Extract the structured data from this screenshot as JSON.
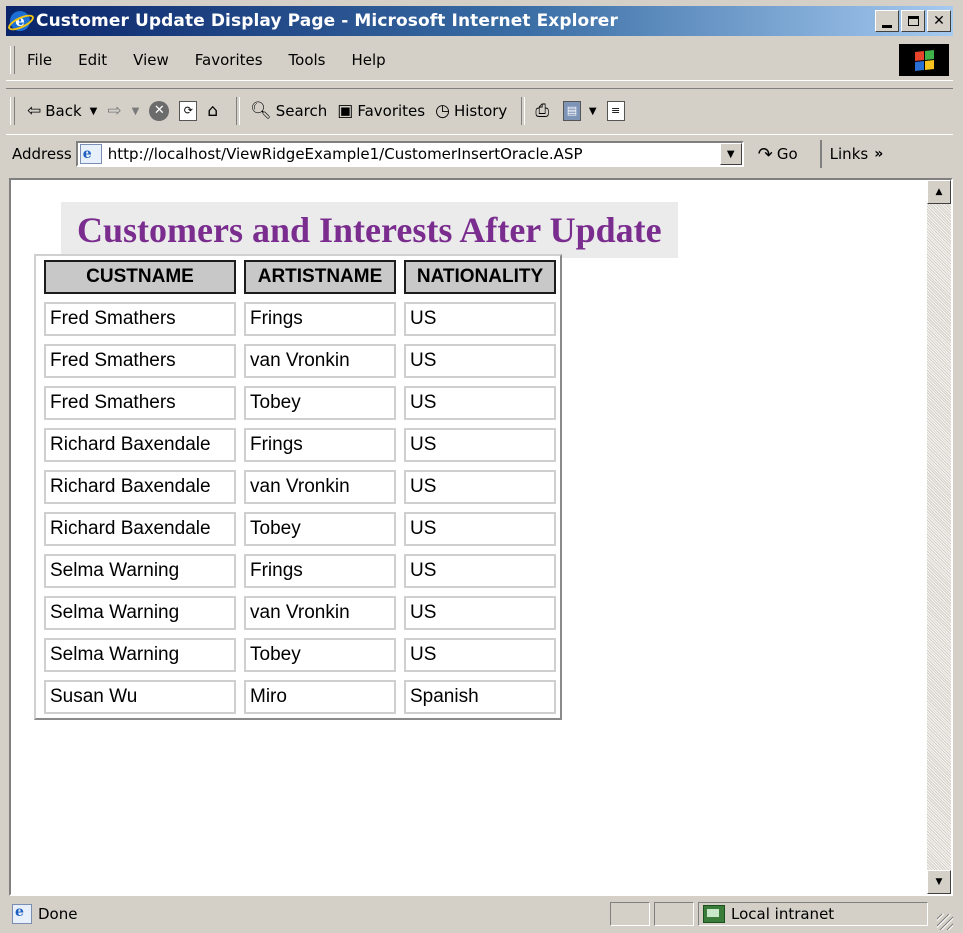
{
  "window": {
    "title": "Customer Update Display Page - Microsoft Internet Explorer"
  },
  "menu": [
    "File",
    "Edit",
    "View",
    "Favorites",
    "Tools",
    "Help"
  ],
  "toolbar": {
    "back": "Back",
    "search": "Search",
    "favorites": "Favorites",
    "history": "History"
  },
  "address": {
    "label": "Address",
    "url": "http://localhost/ViewRidgeExample1/CustomerInsertOracle.ASP",
    "go": "Go",
    "links": "Links"
  },
  "page": {
    "heading": "Customers and Interests After Update",
    "heading_color": "#7a2d8e",
    "columns": [
      "CUSTNAME",
      "ARTISTNAME",
      "NATIONALITY"
    ],
    "rows": [
      [
        "Fred Smathers",
        "Frings",
        "US"
      ],
      [
        "Fred Smathers",
        "van Vronkin",
        "US"
      ],
      [
        "Fred Smathers",
        "Tobey",
        "US"
      ],
      [
        "Richard Baxendale",
        "Frings",
        "US"
      ],
      [
        "Richard Baxendale",
        "van Vronkin",
        "US"
      ],
      [
        "Richard Baxendale",
        "Tobey",
        "US"
      ],
      [
        "Selma Warning",
        "Frings",
        "US"
      ],
      [
        "Selma Warning",
        "van Vronkin",
        "US"
      ],
      [
        "Selma Warning",
        "Tobey",
        "US"
      ],
      [
        "Susan Wu",
        "Miro",
        "Spanish"
      ]
    ]
  },
  "status": {
    "text": "Done",
    "zone": "Local intranet"
  },
  "icons": {
    "app": "ie-logo-icon",
    "throbber": "windows-flag-icon",
    "stop": "stop-icon",
    "refresh": "refresh-icon",
    "home": "home-icon",
    "print": "printer-icon",
    "edit": "edit-icon",
    "mail": "mail-icon"
  }
}
